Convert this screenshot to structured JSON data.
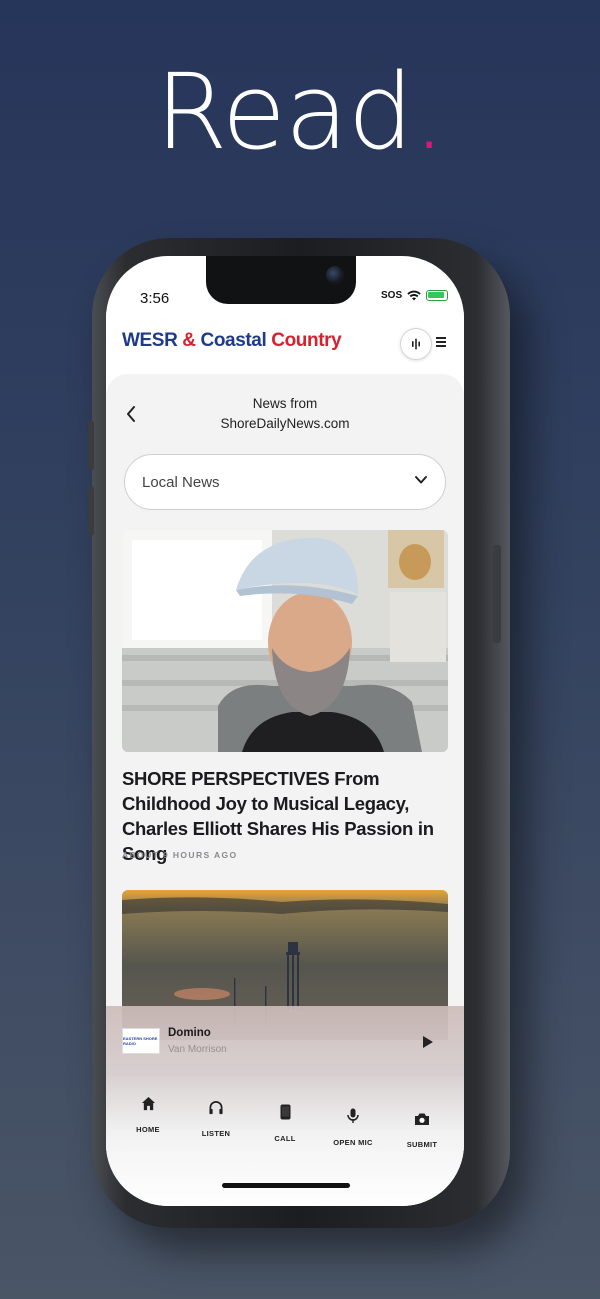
{
  "promo": {
    "headline": "Read",
    "headline_dot": "."
  },
  "status_bar": {
    "time": "3:56",
    "sos": "SOS"
  },
  "app_header": {
    "logo_part1": "WESR",
    "logo_amp": "&",
    "logo_part2": "Coastal",
    "logo_part3": "Country",
    "brand_blue": "#1f3a8a",
    "brand_red": "#d6212f"
  },
  "news_page": {
    "title_line1": "News from",
    "title_line2": "ShoreDailyNews.com",
    "category_dropdown": {
      "selected": "Local News"
    }
  },
  "articles": [
    {
      "title": "SHORE PERSPECTIVES From Childhood Joy to Musical Legacy, Charles Elliott Shares His Passion in Song",
      "meta": "ABOUT 9 HOURS AGO"
    }
  ],
  "now_playing": {
    "title": "Domino",
    "artist": "Van Morrison",
    "art_text": "EASTERN SHORE RADIO"
  },
  "tabbar": {
    "items": [
      {
        "label": "HOME",
        "icon": "home-icon"
      },
      {
        "label": "LISTEN",
        "icon": "headphones-icon"
      },
      {
        "label": "CALL",
        "icon": "phone-icon"
      },
      {
        "label": "OPEN MIC",
        "icon": "microphone-icon"
      },
      {
        "label": "SUBMIT",
        "icon": "camera-icon"
      }
    ]
  },
  "colors": {
    "background": "#26355a",
    "accent_dot": "#e0147a"
  }
}
